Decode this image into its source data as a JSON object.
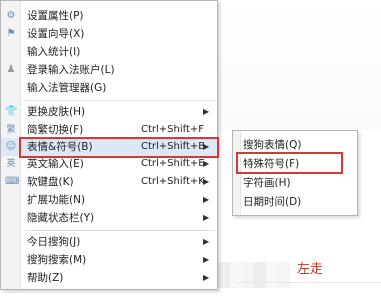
{
  "menu": {
    "items": [
      {
        "label": "设置属性(P)",
        "shortcut": "",
        "icon": "gear-icon",
        "submenu": false
      },
      {
        "label": "设置向导(X)",
        "shortcut": "",
        "icon": "flag-icon",
        "submenu": false
      },
      {
        "label": "输入统计(I)",
        "shortcut": "",
        "icon": "",
        "submenu": false
      },
      {
        "label": "登录输入法账户(L)",
        "shortcut": "",
        "icon": "user-icon",
        "submenu": false
      },
      {
        "label": "输入法管理器(G)",
        "shortcut": "",
        "icon": "",
        "submenu": false
      },
      {
        "label": "更换皮肤(H)",
        "shortcut": "",
        "icon": "shirt-icon",
        "submenu": true
      },
      {
        "label": "简繁切换(F)",
        "shortcut": "Ctrl+Shift+F",
        "icon": "traditional-char-icon",
        "submenu": false
      },
      {
        "label": "表情&符号(B)",
        "shortcut": "Ctrl+Shift+B",
        "icon": "smiley-icon",
        "submenu": true
      },
      {
        "label": "英文输入(E)",
        "shortcut": "Ctrl+Shift+E",
        "icon": "english-icon",
        "submenu": true
      },
      {
        "label": "软键盘(K)",
        "shortcut": "Ctrl+Shift+K",
        "icon": "keyboard-icon",
        "submenu": true
      },
      {
        "label": "扩展功能(N)",
        "shortcut": "",
        "icon": "",
        "submenu": true
      },
      {
        "label": "隐藏状态栏(Y)",
        "shortcut": "",
        "icon": "",
        "submenu": true
      },
      {
        "label": "今日搜狗(J)",
        "shortcut": "",
        "icon": "",
        "submenu": true
      },
      {
        "label": "搜狗搜索(M)",
        "shortcut": "",
        "icon": "",
        "submenu": true
      },
      {
        "label": "帮助(Z)",
        "shortcut": "",
        "icon": "",
        "submenu": true
      }
    ],
    "arrow_glyph": "▶"
  },
  "submenu": {
    "items": [
      {
        "label": "搜狗表情(Q)"
      },
      {
        "label": "特殊符号(F)"
      },
      {
        "label": "字符画(H)"
      },
      {
        "label": "日期时间(D)"
      }
    ]
  },
  "background": {
    "link_text": "左走"
  },
  "colors": {
    "highlight_box": "#d23a3a",
    "icon_blue": "#6a8fb8"
  }
}
